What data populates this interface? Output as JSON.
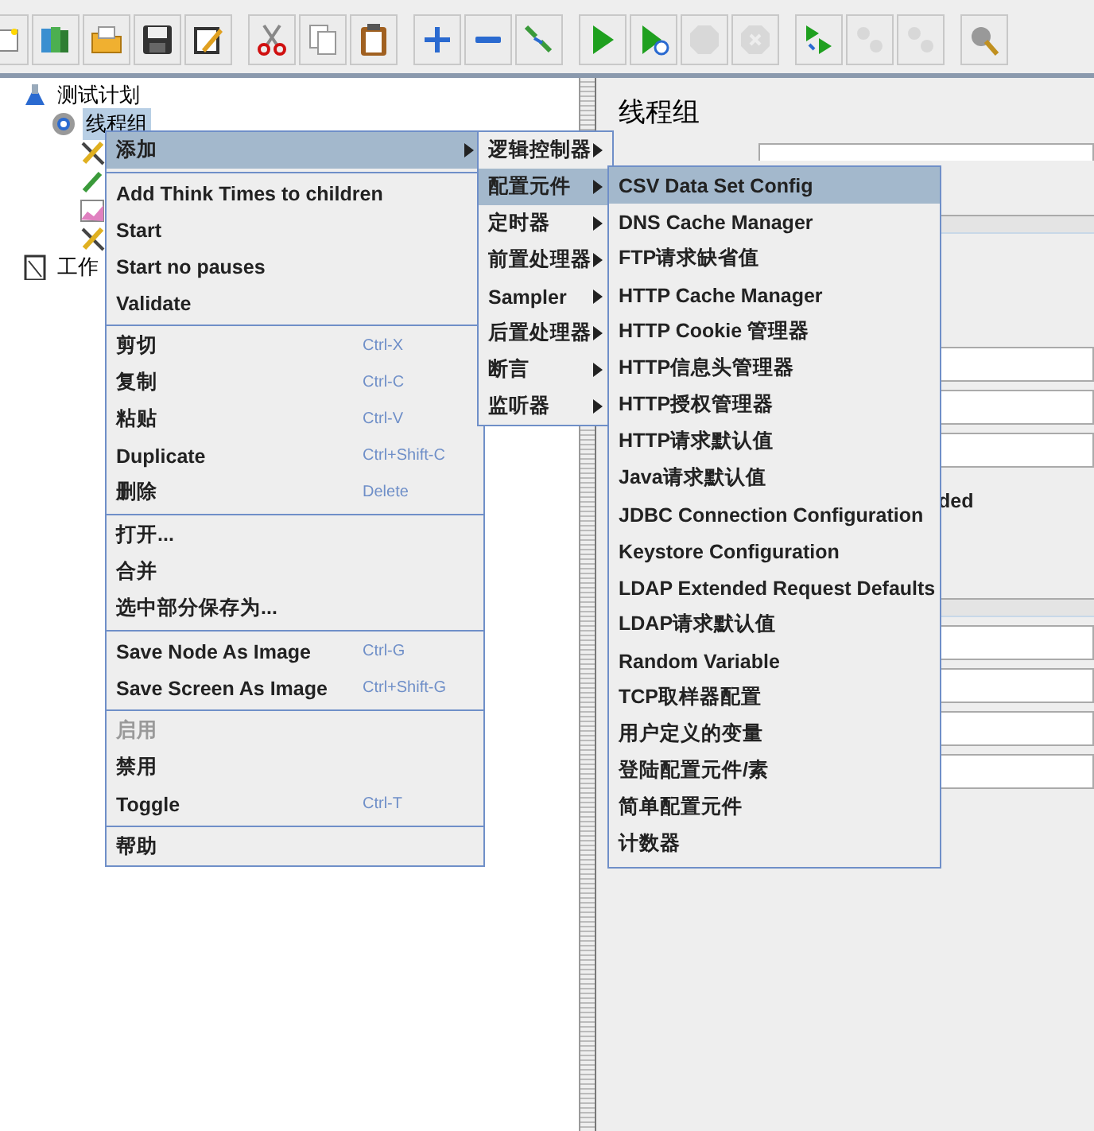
{
  "toolbar": {
    "groups": [
      [
        {
          "kind": "template",
          "disabled": false
        },
        {
          "kind": "open",
          "disabled": false
        },
        {
          "kind": "folder",
          "disabled": false
        },
        {
          "kind": "save",
          "disabled": false
        },
        {
          "kind": "edit",
          "disabled": false
        }
      ],
      [
        {
          "kind": "cut",
          "disabled": false
        },
        {
          "kind": "copy",
          "disabled": false
        },
        {
          "kind": "paste",
          "disabled": false
        }
      ],
      [
        {
          "kind": "expand",
          "disabled": false
        },
        {
          "kind": "collapse",
          "disabled": false
        },
        {
          "kind": "toggle",
          "disabled": false
        }
      ],
      [
        {
          "kind": "start",
          "disabled": false
        },
        {
          "kind": "start-no-pause",
          "disabled": false
        },
        {
          "kind": "stop",
          "disabled": true
        },
        {
          "kind": "shutdown",
          "disabled": true
        }
      ],
      [
        {
          "kind": "remote-start",
          "disabled": false
        },
        {
          "kind": "remote-stop",
          "disabled": true
        },
        {
          "kind": "remote-shutdown",
          "disabled": true
        }
      ],
      [
        {
          "kind": "clear",
          "disabled": false
        }
      ]
    ]
  },
  "tree": [
    {
      "label": "测试计划",
      "kind": "plan",
      "selected": false,
      "children": [
        {
          "label": "线程组",
          "kind": "threads",
          "selected": true,
          "children": [
            {
              "kind": "wrench"
            },
            {
              "kind": "pipette"
            },
            {
              "kind": "chart"
            },
            {
              "kind": "wrench"
            }
          ]
        }
      ]
    },
    {
      "label": "工作",
      "kind": "workbench",
      "selected": false
    }
  ],
  "editor": {
    "title": "线程组",
    "fragment": "ded"
  },
  "context_menu": {
    "sections": [
      [
        {
          "label": "添加",
          "submenu": true,
          "selected": true,
          "disabled": false
        }
      ],
      [
        {
          "label": "Add Think Times to children",
          "selected": false,
          "disabled": false
        },
        {
          "label": "Start",
          "selected": false,
          "disabled": false
        },
        {
          "label": "Start no pauses",
          "selected": false,
          "disabled": false
        },
        {
          "label": "Validate",
          "selected": false,
          "disabled": false
        }
      ],
      [
        {
          "label": "剪切",
          "shortcut": "Ctrl-X",
          "selected": false,
          "disabled": false
        },
        {
          "label": "复制",
          "shortcut": "Ctrl-C",
          "selected": false,
          "disabled": false
        },
        {
          "label": "粘贴",
          "shortcut": "Ctrl-V",
          "selected": false,
          "disabled": false
        },
        {
          "label": "Duplicate",
          "shortcut": "Ctrl+Shift-C",
          "selected": false,
          "disabled": false
        },
        {
          "label": "删除",
          "shortcut": "Delete",
          "selected": false,
          "disabled": false
        }
      ],
      [
        {
          "label": "打开...",
          "selected": false,
          "disabled": false
        },
        {
          "label": "合并",
          "selected": false,
          "disabled": false
        },
        {
          "label": "选中部分保存为...",
          "selected": false,
          "disabled": false
        }
      ],
      [
        {
          "label": "Save Node As Image",
          "shortcut": "Ctrl-G",
          "selected": false,
          "disabled": false
        },
        {
          "label": "Save Screen As Image",
          "shortcut": "Ctrl+Shift-G",
          "selected": false,
          "disabled": false
        }
      ],
      [
        {
          "label": "启用",
          "selected": false,
          "disabled": true
        },
        {
          "label": "禁用",
          "selected": false,
          "disabled": false
        },
        {
          "label": "Toggle",
          "shortcut": "Ctrl-T",
          "selected": false,
          "disabled": false
        }
      ],
      [
        {
          "label": "帮助",
          "selected": false,
          "disabled": false
        }
      ]
    ]
  },
  "add_submenu": {
    "items": [
      {
        "label": "逻辑控制器",
        "submenu": true,
        "selected": false
      },
      {
        "label": "配置元件",
        "submenu": true,
        "selected": true
      },
      {
        "label": "定时器",
        "submenu": true,
        "selected": false
      },
      {
        "label": "前置处理器",
        "submenu": true,
        "selected": false
      },
      {
        "label": "Sampler",
        "submenu": true,
        "selected": false
      },
      {
        "label": "后置处理器",
        "submenu": true,
        "selected": false
      },
      {
        "label": "断言",
        "submenu": true,
        "selected": false
      },
      {
        "label": "监听器",
        "submenu": true,
        "selected": false
      }
    ]
  },
  "config_submenu": {
    "items": [
      {
        "label": "CSV Data Set Config",
        "selected": true
      },
      {
        "label": "DNS Cache Manager",
        "selected": false
      },
      {
        "label": "FTP请求缺省值",
        "selected": false
      },
      {
        "label": "HTTP Cache Manager",
        "selected": false
      },
      {
        "label": "HTTP Cookie 管理器",
        "selected": false
      },
      {
        "label": "HTTP信息头管理器",
        "selected": false
      },
      {
        "label": "HTTP授权管理器",
        "selected": false
      },
      {
        "label": "HTTP请求默认值",
        "selected": false
      },
      {
        "label": "Java请求默认值",
        "selected": false
      },
      {
        "label": "JDBC Connection Configuration",
        "selected": false
      },
      {
        "label": "Keystore Configuration",
        "selected": false
      },
      {
        "label": "LDAP Extended Request Defaults",
        "selected": false
      },
      {
        "label": "LDAP请求默认值",
        "selected": false
      },
      {
        "label": "Random Variable",
        "selected": false
      },
      {
        "label": "TCP取样器配置",
        "selected": false
      },
      {
        "label": "用户定义的变量",
        "selected": false
      },
      {
        "label": "登陆配置元件/素",
        "selected": false
      },
      {
        "label": "简单配置元件",
        "selected": false
      },
      {
        "label": "计数器",
        "selected": false
      }
    ]
  }
}
